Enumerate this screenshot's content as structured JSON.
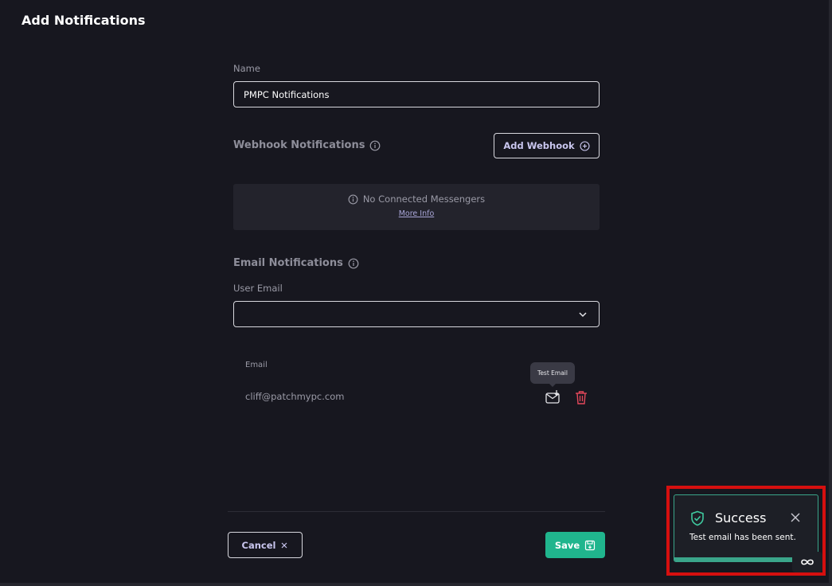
{
  "page": {
    "title": "Add Notifications"
  },
  "name_field": {
    "label": "Name",
    "value": "PMPC Notifications"
  },
  "webhook": {
    "title": "Webhook Notifications",
    "add_button": "Add Webhook",
    "empty_message": "No Connected Messengers",
    "more_info": "More Info"
  },
  "email": {
    "title": "Email Notifications",
    "user_email_label": "User Email",
    "user_email_value": "",
    "column_header": "Email",
    "rows": [
      {
        "address": "cliff@patchmypc.com"
      }
    ],
    "tooltip": "Test Email"
  },
  "footer": {
    "cancel_label": "Cancel",
    "save_label": "Save"
  },
  "toast": {
    "title": "Success",
    "message": "Test email has been sent.",
    "progress": 0.82
  },
  "colors": {
    "background": "#17171f",
    "accent": "#20b58d",
    "danger": "#e5485b",
    "highlight": "#d60f0f"
  },
  "icons": [
    "info-icon",
    "plus-circle-icon",
    "chevron-down-icon",
    "mail-download-icon",
    "trash-icon",
    "close-icon",
    "save-icon",
    "shield-check-icon",
    "infinity-icon"
  ]
}
